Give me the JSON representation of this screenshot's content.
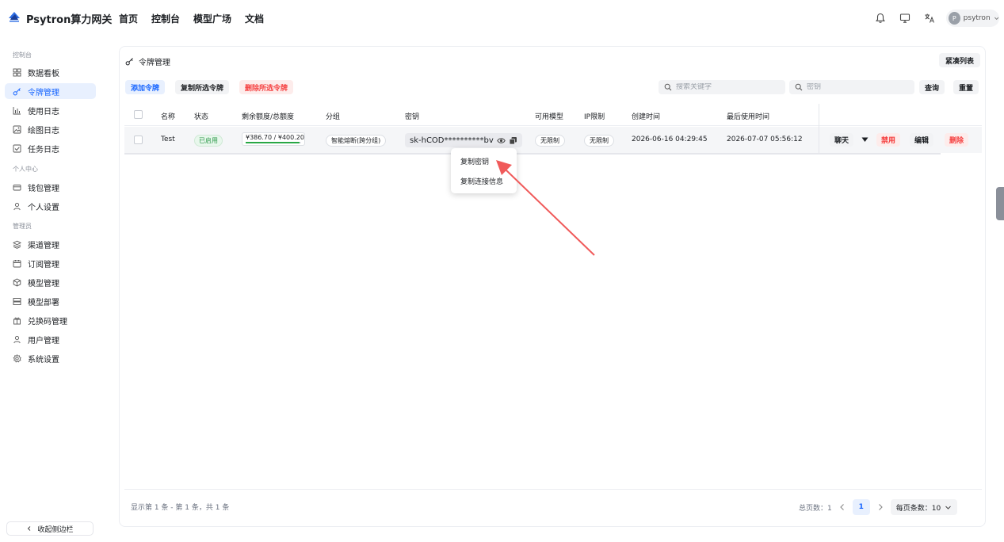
{
  "app": {
    "brand": "Psytron算力网关",
    "nav": [
      "首页",
      "控制台",
      "模型广场",
      "文档"
    ],
    "user": {
      "avatar_letter": "P",
      "name": "psytron"
    }
  },
  "sidebar": {
    "sections": [
      {
        "title": "控制台",
        "items": [
          {
            "label": "数据看板",
            "icon": "dashboard-icon"
          },
          {
            "label": "令牌管理",
            "icon": "key-icon",
            "active": true
          },
          {
            "label": "使用日志",
            "icon": "bar-chart-icon"
          },
          {
            "label": "绘图日志",
            "icon": "image-icon"
          },
          {
            "label": "任务日志",
            "icon": "checkbox-icon"
          }
        ]
      },
      {
        "title": "个人中心",
        "items": [
          {
            "label": "钱包管理",
            "icon": "wallet-icon"
          },
          {
            "label": "个人设置",
            "icon": "user-icon"
          }
        ]
      },
      {
        "title": "管理员",
        "items": [
          {
            "label": "渠道管理",
            "icon": "layers-icon"
          },
          {
            "label": "订阅管理",
            "icon": "calendar-icon"
          },
          {
            "label": "模型管理",
            "icon": "cube-icon"
          },
          {
            "label": "模型部署",
            "icon": "server-icon"
          },
          {
            "label": "兑换码管理",
            "icon": "gift-icon"
          },
          {
            "label": "用户管理",
            "icon": "user-icon"
          },
          {
            "label": "系统设置",
            "icon": "settings-icon"
          }
        ]
      }
    ],
    "collapse_label": "收起侧边栏"
  },
  "page": {
    "title": "令牌管理",
    "compact_label": "紧凑列表",
    "toolbar": {
      "add": "添加令牌",
      "copy_selected": "复制所选令牌",
      "delete_selected": "删除所选令牌",
      "search_placeholder": "搜索关键字",
      "key_placeholder": "密钥",
      "query": "查询",
      "reset": "重置"
    },
    "columns": [
      "名称",
      "状态",
      "剩余额度/总额度",
      "分组",
      "密钥",
      "可用模型",
      "IP限制",
      "创建时间",
      "最后使用时间"
    ],
    "rows": [
      {
        "name": "Test",
        "status": "已启用",
        "quota": "¥386.70 / ¥400.20",
        "quota_fraction": 0.966,
        "group": "智能熔断(跨分组)",
        "key": "sk-hCOD**********bv",
        "models": "无限制",
        "ip": "无限制",
        "created": "2026-06-16 04:29:45",
        "last_used": "2026-07-07 05:56:12",
        "actions": {
          "chat": "聊天",
          "disable": "禁用",
          "edit": "编辑",
          "delete": "删除"
        }
      }
    ],
    "dropdown": [
      "复制密钥",
      "复制连接信息"
    ],
    "footer": {
      "info": "显示第 1 条 - 第 1 条，共 1 条",
      "total_pages": "总页数：1",
      "current_page": "1",
      "page_size": "每页条数：10"
    }
  },
  "colors": {
    "accent": "#1664ff",
    "danger": "#f53f3f",
    "success": "#28a745",
    "annotation_arrow": "#f05a5a"
  }
}
